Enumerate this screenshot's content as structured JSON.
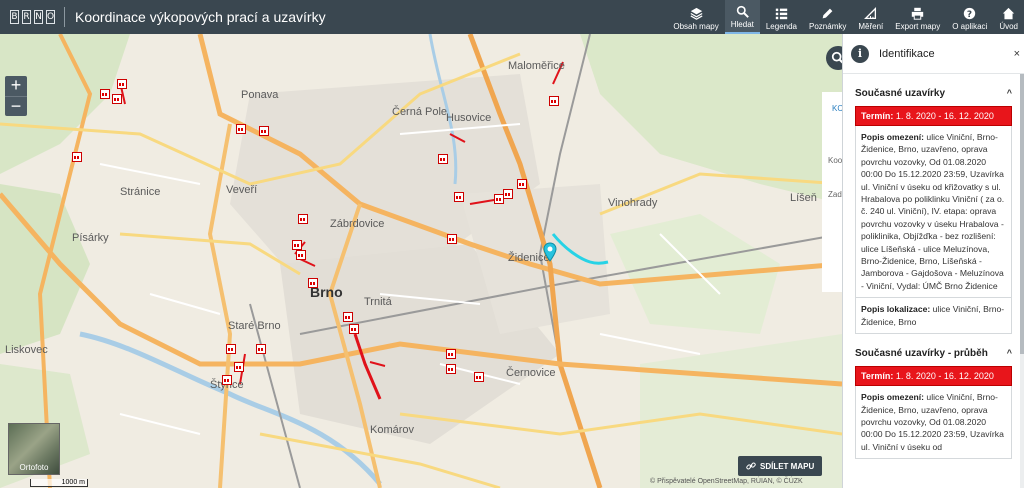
{
  "header": {
    "logo_letters": [
      "B",
      "R",
      "N",
      "O"
    ],
    "title": "Koordinace výkopových prací a uzavírky"
  },
  "toolbar": {
    "items": [
      {
        "label": "Obsah mapy",
        "icon": "layers-icon"
      },
      {
        "label": "Hledat",
        "icon": "search-icon",
        "active": true
      },
      {
        "label": "Legenda",
        "icon": "list-icon"
      },
      {
        "label": "Poznámky",
        "icon": "pencil-icon"
      },
      {
        "label": "Měření",
        "icon": "ruler-icon"
      },
      {
        "label": "Export mapy",
        "icon": "printer-icon"
      },
      {
        "label": "O aplikaci",
        "icon": "help-icon"
      },
      {
        "label": "Úvod",
        "icon": "home-icon"
      }
    ]
  },
  "map": {
    "zoom_in": "+",
    "zoom_out": "−",
    "labels": {
      "malomerice": "Maloměřice",
      "ponava": "Ponava",
      "cerna_pole": "Černá Pole",
      "husovice": "Husovice",
      "stranice": "Stránice",
      "vevericka": "Veveří",
      "zabrdovice": "Zábrdovice",
      "vinohrady": "Vinohrady",
      "lisen": "Líšeň",
      "pisarky": "Písárky",
      "zidenice": "Židenice",
      "brno": "Brno",
      "trnita": "Trnitá",
      "stare_brno": "Staré Brno",
      "liskovec": "Liskovec",
      "styrice": "Štýřice",
      "cernovice": "Černovice",
      "komarov": "Komárov"
    },
    "ortofoto_label": "Ortofoto",
    "scale_label": "1000 m",
    "attribution": "© Přispěvatelé OpenStreetMap, RÚIAN, © ČÚZK",
    "share_button": "SDÍLET MAPU",
    "underlay_tab": "KC",
    "underlay_label_1": "Kooi",
    "underlay_label_2": "Zadi"
  },
  "panel": {
    "title": "Identifikace",
    "close": "×",
    "sections": [
      {
        "heading": "Současné uzavírky",
        "term_label": "Termín:",
        "term_value": "1. 8. 2020 - 16. 12. 2020",
        "popis_label": "Popis omezení:",
        "popis_text": "ulice Viniční, Brno-Židenice, Brno, uzavřeno, oprava povrchu vozovky, Od 01.08.2020 00:00 Do 15.12.2020 23:59, Uzavírka ul. Viniční v úseku od křižovatky s ul. Hrabalova po poliklinku Viniční ( za o. č. 240 ul. Viniční), IV. etapa: oprava povrchu vozovky v úseku Hrabalova - poliklinika, Objížďka - bez rozlišení: ulice Líšeňská - ulice Meluzínova, Brno-Židenice, Brno, Líšeňská - Jamborova - Gajdošova - Meluzínova - Viniční, Vydal: ÚMČ Brno Židenice",
        "lokal_label": "Popis lokalizace:",
        "lokal_text": "ulice Viniční, Brno-Židenice, Brno"
      },
      {
        "heading": "Současné uzavírky - průběh",
        "term_label": "Termín:",
        "term_value": "1. 8. 2020 - 16. 12. 2020",
        "popis_label": "Popis omezení:",
        "popis_text": "ulice Viniční, Brno-Židenice, Brno, uzavřeno, oprava povrchu vozovky, Od 01.08.2020 00:00 Do 15.12.2020 23:59, Uzavírka ul. Viniční v úseku od"
      }
    ]
  },
  "colors": {
    "topbar": "#3a4750",
    "closure_red": "#e8151b",
    "highlight_route": "#27d3e6"
  }
}
